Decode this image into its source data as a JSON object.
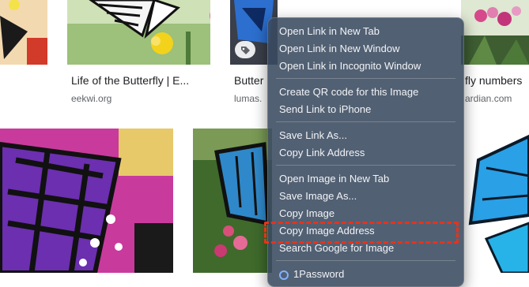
{
  "results": [
    {
      "caption": "Life of the Butterfly | E...",
      "source": "eekwi.org"
    },
    {
      "caption": "Butter",
      "source": "lumas."
    },
    {
      "caption": "fly numbers",
      "source": "ardian.com"
    }
  ],
  "context_menu": {
    "items": [
      "Open Link in New Tab",
      "Open Link in New Window",
      "Open Link in Incognito Window",
      "Create QR code for this Image",
      "Send Link to iPhone",
      "Save Link As...",
      "Copy Link Address",
      "Open Image in New Tab",
      "Save Image As...",
      "Copy Image",
      "Copy Image Address",
      "Search Google for Image",
      "1Password"
    ],
    "highlighted_item": "Copy Image Address"
  },
  "colors": {
    "menu_background": "#3a4a60",
    "highlight_border": "#e8321b",
    "caption_text": "#202124",
    "source_text": "#5f6368"
  },
  "icons": [
    "tag-icon",
    "1password-icon"
  ]
}
